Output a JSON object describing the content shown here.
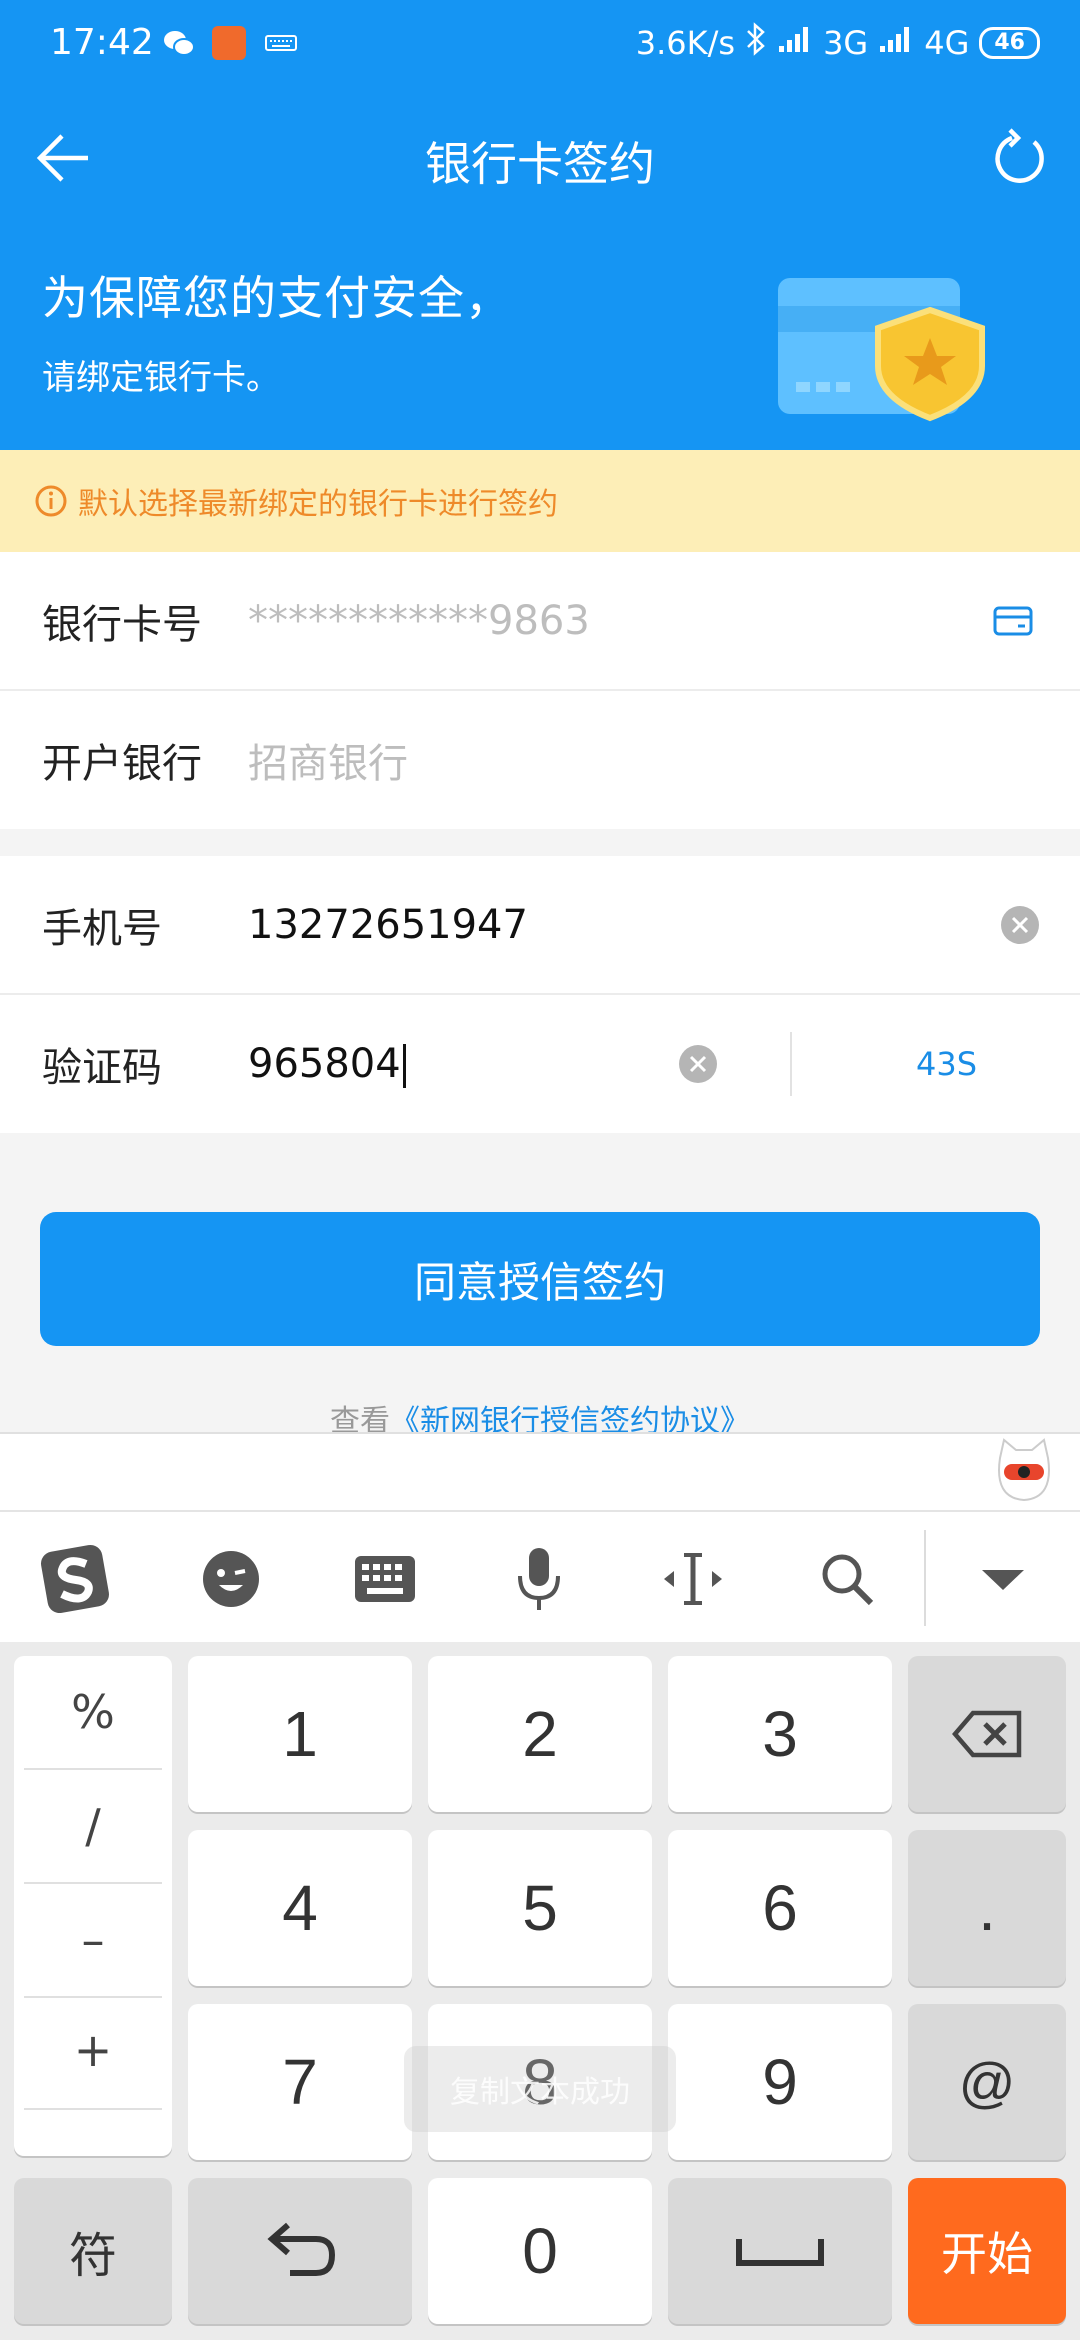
{
  "status_bar": {
    "time": "17:42",
    "speed": "3.6K/s",
    "net1": "3G",
    "net2": "4G",
    "battery": "46"
  },
  "header": {
    "title": "银行卡签约",
    "back_icon": "arrow-left-icon",
    "refresh_icon": "refresh-icon"
  },
  "banner": {
    "line1": "为保障您的支付安全，",
    "line2": "请绑定银行卡。"
  },
  "notice": {
    "text": "默认选择最新绑定的银行卡进行签约"
  },
  "form": {
    "card_label": "银行卡号",
    "card_value": "************9863",
    "bank_label": "开户银行",
    "bank_value": "招商银行",
    "phone_label": "手机号",
    "phone_value": "13272651947",
    "code_label": "验证码",
    "code_value": "965804",
    "countdown": "43S"
  },
  "primary_button": "同意授信签约",
  "agreement": {
    "prefix": "查看",
    "link": "《新网银行授信签约协议》"
  },
  "keyboard": {
    "symbols": [
      "%",
      "/",
      "–",
      "+"
    ],
    "digits": [
      "1",
      "2",
      "3",
      "4",
      "5",
      "6",
      "7",
      "8",
      "9",
      "0"
    ],
    "dot": ".",
    "at": "@",
    "sym_key": "符",
    "go_key": "开始"
  },
  "toast": "复制文本成功",
  "colors": {
    "brand_blue": "#1595f3",
    "notice_bg": "#fdeeb7",
    "notice_text": "#ee8a2a",
    "go_key": "#ff6a1e"
  }
}
